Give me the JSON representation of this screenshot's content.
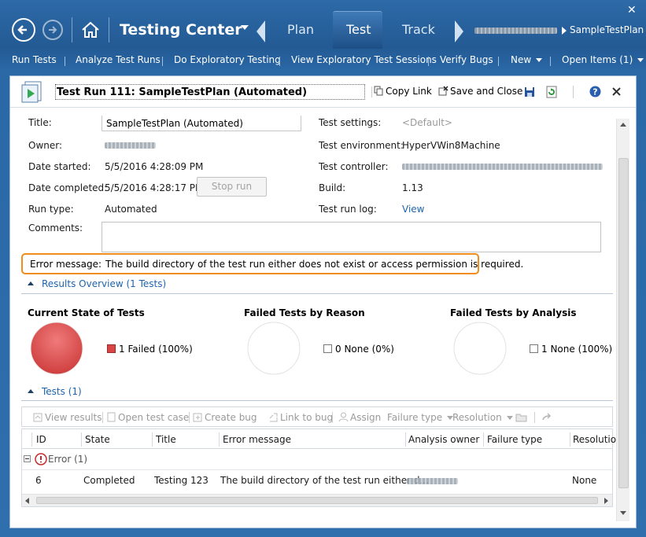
{
  "window": {
    "close_label": "✕"
  },
  "nav": {
    "app_title": "Testing Center",
    "hubs": {
      "plan": "Plan",
      "test": "Test",
      "track": "Track"
    },
    "breadcrumb_plan": "SampleTestPlan"
  },
  "commands": {
    "run_tests": "Run Tests",
    "analyze_test_runs": "Analyze Test Runs",
    "do_exploratory_testing": "Do Exploratory Testing",
    "view_exploratory_sessions": "View Exploratory Test Sessions",
    "verify_bugs": "Verify Bugs",
    "new": "New",
    "open_items": "Open Items (1)"
  },
  "document": {
    "title": "Test Run 111: SampleTestPlan (Automated)",
    "toolbar": {
      "copy_link": "Copy Link",
      "save_and_close": "Save and Close"
    }
  },
  "form": {
    "title_label": "Title:",
    "title_value": "SampleTestPlan (Automated)",
    "owner_label": "Owner:",
    "date_started_label": "Date started:",
    "date_started_value": "5/5/2016 4:28:09 PM",
    "date_completed_label": "Date completed:",
    "date_completed_value": "5/5/2016 4:28:17 PM",
    "stop_run_label": "Stop run",
    "run_type_label": "Run type:",
    "run_type_value": "Automated",
    "comments_label": "Comments:",
    "test_settings_label": "Test settings:",
    "test_settings_value": "<Default>",
    "test_environment_label": "Test environment:",
    "test_environment_value": "HyperVWin8Machine",
    "test_controller_label": "Test controller:",
    "build_label": "Build:",
    "build_value": "1.13",
    "test_run_log_label": "Test run log:",
    "test_run_log_value": "View",
    "error_message_label": "Error message:",
    "error_message_value": "The build directory of the test run either does not exist or access permission is required."
  },
  "results_overview": {
    "header": "Results Overview (1 Tests)",
    "charts": [
      {
        "title": "Current State of Tests",
        "legend": "1 Failed (100%)"
      },
      {
        "title": "Failed Tests by Reason",
        "legend": "0 None (0%)"
      },
      {
        "title": "Failed Tests by Analysis",
        "legend": "1 None (100%)"
      }
    ]
  },
  "chart_data": [
    {
      "type": "pie",
      "title": "Current State of Tests",
      "categories": [
        "Failed"
      ],
      "values": [
        1
      ],
      "colors": [
        "#d94545"
      ]
    },
    {
      "type": "pie",
      "title": "Failed Tests by Reason",
      "categories": [
        "None"
      ],
      "values": [
        0
      ]
    },
    {
      "type": "pie",
      "title": "Failed Tests by Analysis",
      "categories": [
        "None"
      ],
      "values": [
        1
      ]
    }
  ],
  "tests": {
    "header": "Tests (1)",
    "toolbar": {
      "view_results": "View results",
      "open_test_case": "Open test case",
      "create_bug": "Create bug",
      "link_to_bug": "Link to bug",
      "assign": "Assign",
      "failure_type": "Failure type",
      "resolution": "Resolution"
    },
    "columns": {
      "id": "ID",
      "state": "State",
      "title": "Title",
      "error_message": "Error message",
      "analysis_owner": "Analysis owner",
      "failure_type": "Failure type",
      "resolution": "Resolutio"
    },
    "group_label": "Error (1)",
    "rows": [
      {
        "id": "6",
        "state": "Completed",
        "title": "Testing 123",
        "error_message": "The build directory of the test run either d...",
        "failure_type": "",
        "resolution": "None"
      }
    ]
  },
  "colors": {
    "accent": "#2a68a6",
    "error_highlight": "#f28c1c",
    "failed": "#d94545",
    "link": "#1e64ad"
  }
}
